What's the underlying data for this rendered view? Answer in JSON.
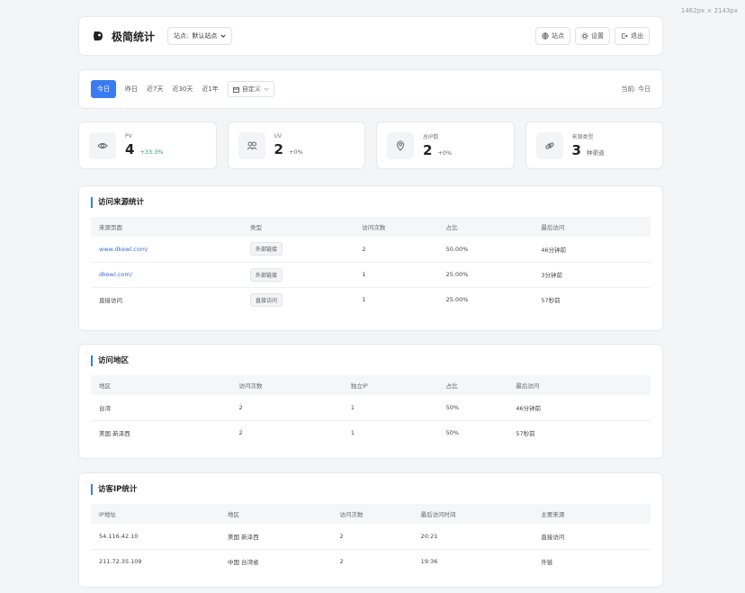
{
  "screenshot_dims": "1462px × 2143px",
  "header": {
    "title": "极简统计",
    "site_label": "站点:",
    "site_value": "默认站点",
    "btn_site": "站点",
    "btn_settings": "设置",
    "btn_logout": "退出"
  },
  "datebar": {
    "tabs": [
      "今日",
      "昨日",
      "近7天",
      "近30天",
      "近1年"
    ],
    "custom": "自定义",
    "current": "当前: 今日"
  },
  "stats": [
    {
      "label": "PV",
      "value": "4",
      "delta": "+33.3%",
      "icon": "eye-icon"
    },
    {
      "label": "UV",
      "value": "2",
      "delta": "+0%",
      "icon": "users-icon"
    },
    {
      "label": "总IP数",
      "value": "2",
      "delta": "+0%",
      "icon": "location-icon"
    },
    {
      "label": "来源类型",
      "value": "3",
      "delta": "种渠道",
      "icon": "link-icon"
    }
  ],
  "sources": {
    "title": "访问来源统计",
    "headers": [
      "来源页面",
      "类型",
      "访问次数",
      "占比",
      "最后访问"
    ],
    "rows": [
      [
        "www.dkewl.com/",
        "外部链接",
        "2",
        "50.00%",
        "46分钟前"
      ],
      [
        "dkewl.com/",
        "外部链接",
        "1",
        "25.00%",
        "3分钟前"
      ],
      [
        "直接访问",
        "直接访问",
        "1",
        "25.00%",
        "57秒前"
      ]
    ]
  },
  "regions": {
    "title": "访问地区",
    "headers": [
      "地区",
      "访问次数",
      "独立IP",
      "占比",
      "最后访问"
    ],
    "rows": [
      [
        "台湾",
        "2",
        "1",
        "50%",
        "46分钟前"
      ],
      [
        "美国 新泽西",
        "2",
        "1",
        "50%",
        "57秒前"
      ]
    ]
  },
  "ips": {
    "title": "访客IP统计",
    "headers": [
      "IP地址",
      "地区",
      "访问次数",
      "最后访问时间",
      "主要来源"
    ],
    "rows": [
      [
        "54.116.42.10",
        "美国 新泽西",
        "2",
        "20:21",
        "直接访问"
      ],
      [
        "211.72.35.109",
        "中国 台湾省",
        "2",
        "19:36",
        "外链"
      ]
    ]
  }
}
